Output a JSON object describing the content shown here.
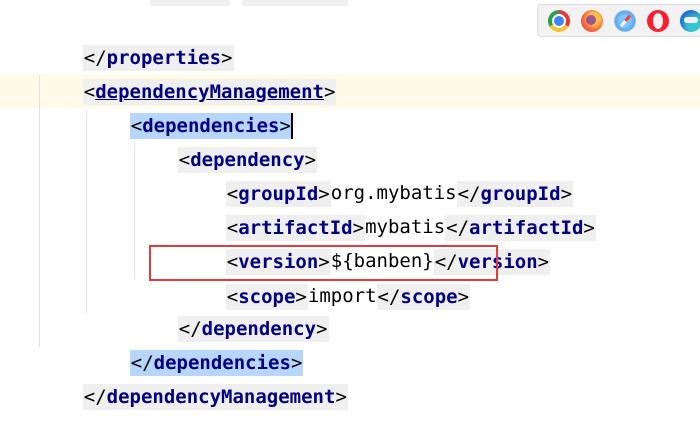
{
  "editor": {
    "lines": [
      {
        "open": "</",
        "tag": "properties",
        "close": ">"
      },
      {
        "open": "<",
        "tag": "dependencyManagement",
        "close": ">"
      },
      {
        "open": "<",
        "tag": "dependencies",
        "close": ">"
      },
      {
        "open": "<",
        "tag": "dependency",
        "close": ">"
      },
      {
        "open": "<",
        "tag": "groupId",
        "close": ">",
        "value": "org.mybatis",
        "end_open": "</",
        "end_tag": "groupId",
        "end_close": ">"
      },
      {
        "open": "<",
        "tag": "artifactId",
        "close": ">",
        "value": "mybatis",
        "end_open": "</",
        "end_tag": "artifactId",
        "end_close": ">"
      },
      {
        "open": "<",
        "tag": "version",
        "close": ">",
        "value": "${banben}",
        "end_open": "</",
        "end_tag": "version",
        "end_close": ">"
      },
      {
        "open": "<",
        "tag": "scope",
        "close": ">",
        "value": "import",
        "end_open": "</",
        "end_tag": "scope",
        "end_close": ">"
      },
      {
        "open": "</",
        "tag": "dependency",
        "close": ">"
      },
      {
        "open": "</",
        "tag": "dependencies",
        "close": ">"
      },
      {
        "open": "</",
        "tag": "dependencyManagement",
        "close": ">"
      }
    ],
    "highlighted_line": "scope"
  },
  "browser_icons": [
    "chrome-icon",
    "firefox-icon",
    "safari-icon",
    "opera-icon",
    "edge-icon"
  ],
  "colors": {
    "tag": "#000080",
    "selection": "#b6d6fd",
    "highlight_box": "#e23b3b",
    "caret_line": "#fffbe8"
  }
}
